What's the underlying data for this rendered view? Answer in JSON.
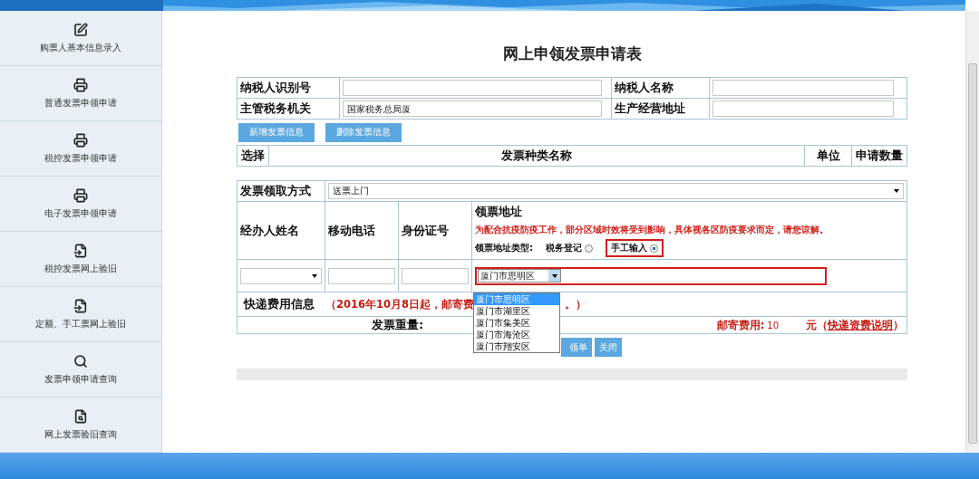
{
  "title": "网上申领发票申请表",
  "sidebar": {
    "items": [
      {
        "label": "购票人基本信息录入",
        "kind": "edit"
      },
      {
        "label": "普通发票申领申请",
        "kind": "apply"
      },
      {
        "label": "税控发票申领申请",
        "kind": "apply"
      },
      {
        "label": "电子发票申领申请",
        "kind": "apply"
      },
      {
        "label": "税控发票网上验旧",
        "kind": "return"
      },
      {
        "label": "定额、手工票网上验旧",
        "kind": "return"
      },
      {
        "label": "发票申领申请查询",
        "kind": "search"
      },
      {
        "label": "网上发票验旧查询",
        "kind": "doc-search"
      }
    ]
  },
  "taxpayer_fields": [
    {
      "label": "纳税人识别号"
    },
    {
      "label": "纳税人名称"
    },
    {
      "label": "主管税务机关",
      "value": "国家税务总局厦"
    },
    {
      "label": "生产经营地址"
    }
  ],
  "invoice_buttons": [
    "新增发票信息",
    "删除发票信息"
  ],
  "invoice_table": {
    "columns": [
      "选择",
      "发票种类名称",
      "单位",
      "申请数量"
    ]
  },
  "pickup": {
    "label": "发票领取方式",
    "value": "送票上门"
  },
  "handler_columns": [
    "经办人姓名",
    "移动电话",
    "身份证号"
  ],
  "address": {
    "label": "领票地址",
    "notice": "为配合抗疫防疫工作，部分区域时效将受到影响，具体视各区防疫要求而定，请您谅解。",
    "type_label": "领票地址类型:",
    "options": [
      {
        "label": "税务登记",
        "selected": false
      },
      {
        "label": "手工输入",
        "selected": true
      }
    ],
    "district": "厦门市思明区"
  },
  "district_dropdown": [
    {
      "label": "厦门市思明区",
      "selected": true
    },
    {
      "label": "厦门市湖里区",
      "selected": false
    },
    {
      "label": "厦门市集美区",
      "selected": false
    },
    {
      "label": "厦门市海沧区",
      "selected": false
    },
    {
      "label": "厦门市翔安区",
      "selected": false
    }
  ],
  "shipping": {
    "label": "快递费用信息",
    "notice_start": "（2016年10月8日起，邮寄费",
    "notice_end": "。）",
    "weight_label": "发票重量:",
    "fee_label": "邮寄费用:",
    "fee": "10",
    "unit": "元（",
    "link": "快递资费说明",
    "close": "）"
  },
  "actions": [
    "领单",
    "关闭"
  ]
}
